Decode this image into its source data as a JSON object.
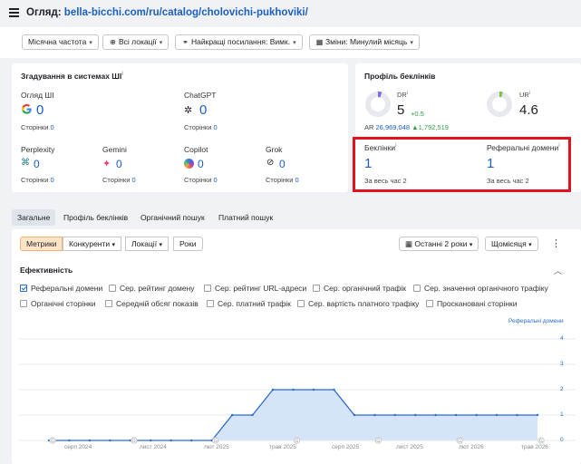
{
  "header": {
    "title_prefix": "Огляд:",
    "url": "bella-bicchi.com/ru/catalog/cholovichi-pukhoviki/"
  },
  "filters": [
    {
      "label": "Місячна частота",
      "icon": "none"
    },
    {
      "label": "Всі локації",
      "icon": "globe-icon"
    },
    {
      "label": "Найкращі посилання: Вимк.",
      "icon": "link-icon"
    },
    {
      "label": "Зміни: Минулий місяць",
      "icon": "calendar-icon"
    }
  ],
  "ai": {
    "title": "Згадування в системах ШІ",
    "items": [
      {
        "name": "Огляд ШІ",
        "value": "0",
        "pages_label": "Сторінки",
        "pages": "0",
        "icon": "google-icon"
      },
      {
        "name": "ChatGPT",
        "value": "0",
        "pages_label": "Сторінки",
        "pages": "0",
        "icon": "chatgpt-icon"
      },
      {
        "name": "Perplexity",
        "value": "0",
        "pages_label": "Сторінки",
        "pages": "0",
        "icon": "perplexity-icon"
      },
      {
        "name": "Gemini",
        "value": "0",
        "pages_label": "Сторінки",
        "pages": "0",
        "icon": "gemini-icon"
      },
      {
        "name": "Copilot",
        "value": "0",
        "pages_label": "Сторінки",
        "pages": "0",
        "icon": "copilot-icon"
      },
      {
        "name": "Grok",
        "value": "0",
        "pages_label": "Сторінки",
        "pages": "0",
        "icon": "grok-icon"
      }
    ]
  },
  "profile": {
    "title": "Профіль беклінків",
    "dr_label": "DR",
    "dr_value": "5",
    "dr_delta": "+0.5",
    "ur_label": "UR",
    "ur_value": "4.6",
    "ar_label": "AR",
    "ar_value": "26,969,048",
    "ar_delta": "▲1,792,519",
    "backlinks_label": "Беклінки",
    "backlinks_value": "1",
    "backlinks_all_label": "За весь час",
    "backlinks_all": "2",
    "refdomains_label": "Реферальні домени",
    "refdomains_value": "1",
    "refdomains_all_label": "За весь час",
    "refdomains_all": "2",
    "colors": {
      "dr_ring": "#7b6cd9",
      "ur_ring": "#7fc23f",
      "delta": "#2e9e46"
    }
  },
  "tabs": [
    "Загальне",
    "Профіль беклінків",
    "Органічний пошук",
    "Платний пошук"
  ],
  "segments": [
    "Метрики",
    "Конкуренти",
    "Локації",
    "Роки"
  ],
  "range_btn": "Останні 2 роки",
  "period_btn": "Щомісяця",
  "panel_title": "Ефективність",
  "checkboxes": [
    {
      "label": "Реферальні домени",
      "checked": true
    },
    {
      "label": "Сер. рейтинг домену",
      "checked": false
    },
    {
      "label": "Сер. рейтинг URL-адреси",
      "checked": false
    },
    {
      "label": "Сер. органічний трафік",
      "checked": false
    },
    {
      "label": "Сер. значення органічного трафіку",
      "checked": false
    },
    {
      "label": "Органічні сторінки",
      "checked": false
    },
    {
      "label": "Середній обсяг показів",
      "checked": false
    },
    {
      "label": "Сер. платний трафік",
      "checked": false
    },
    {
      "label": "Сер. вартість платного трафіку",
      "checked": false
    },
    {
      "label": "Просканованi сторінки",
      "checked": false
    }
  ],
  "chart_data": {
    "type": "area",
    "series": [
      {
        "name": "Реферальні домени",
        "values": [
          0,
          0,
          0,
          0,
          0,
          0,
          0,
          0,
          0,
          1,
          1,
          2,
          2,
          2,
          2,
          1,
          1,
          1,
          1,
          1,
          1,
          1,
          1,
          1,
          1
        ]
      }
    ],
    "x_tick_labels": [
      "серп 2024",
      "лист 2024",
      "лют 2025",
      "трав 2025",
      "серп 2025",
      "лист 2025",
      "лют 2026",
      "трав 2026"
    ],
    "y_ticks": [
      "4",
      "3",
      "2",
      "1",
      "0"
    ],
    "ylim": [
      0,
      4
    ],
    "color": "#2b6cd1",
    "legend": "top-right"
  }
}
